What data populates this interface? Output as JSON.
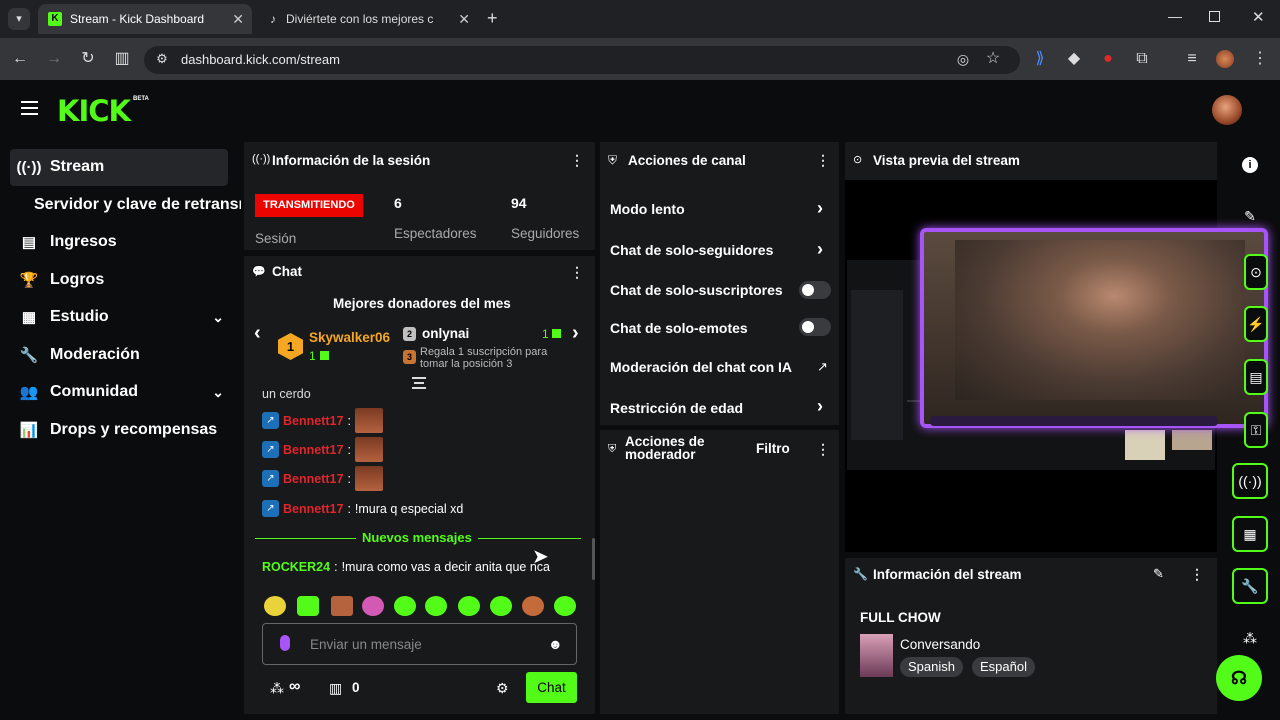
{
  "browser": {
    "tabs": [
      {
        "label": "Stream - Kick Dashboard"
      },
      {
        "label": "Diviértete con los mejores c"
      }
    ],
    "url": "dashboard.kick.com/stream"
  },
  "logo": {
    "text": "KICK",
    "beta": "BETA"
  },
  "sidebar": {
    "items": [
      {
        "label": "Stream"
      },
      {
        "label": "Servidor y clave de retransm"
      },
      {
        "label": "Ingresos"
      },
      {
        "label": "Logros"
      },
      {
        "label": "Estudio"
      },
      {
        "label": "Moderación"
      },
      {
        "label": "Comunidad"
      },
      {
        "label": "Drops y recompensas"
      }
    ]
  },
  "session": {
    "title": "Información de la sesión",
    "status": "TRANSMITIENDO",
    "status_label": "Sesión",
    "viewers": "6",
    "viewers_label": "Espectadores",
    "followers": "94",
    "followers_label": "Seguidores"
  },
  "chat": {
    "title": "Chat",
    "donors_title": "Mejores donadores del mes",
    "donor1": {
      "rank": "1",
      "name": "Skywalker06",
      "count": "1"
    },
    "donor2": {
      "rank": "2",
      "name": "onlynai",
      "count": "1"
    },
    "donor3": {
      "rank": "3",
      "text": "Regala 1 suscripción para tomar la posición 3"
    },
    "cut_text": "un cerdo",
    "messages": [
      {
        "user": "Bennett17",
        "text": ""
      },
      {
        "user": "Bennett17",
        "text": ""
      },
      {
        "user": "Bennett17",
        "text": ""
      },
      {
        "user": "Bennett17",
        "text": "!mura q especial xd"
      }
    ],
    "new_messages": "Nuevos mensajes",
    "latest": {
      "user": "ROCKER24",
      "text": "!mura como vas a decir anita que nca"
    },
    "input_placeholder": "Enviar un mensaje",
    "points": "∞",
    "shop_count": "0",
    "send_label": "Chat"
  },
  "channel_actions": {
    "title": "Acciones de canal",
    "rows": [
      {
        "label": "Modo lento"
      },
      {
        "label": "Chat de solo-seguidores"
      },
      {
        "label": "Chat de solo-suscriptores"
      },
      {
        "label": "Chat de solo-emotes"
      },
      {
        "label": "Moderación del chat con IA"
      },
      {
        "label": "Restricción de edad"
      }
    ]
  },
  "mod_actions": {
    "title": "Acciones de moderador",
    "filter": "Filtro"
  },
  "preview": {
    "title": "Vista previa del stream"
  },
  "stream_info": {
    "title": "Información del stream",
    "stream_title": "FULL CHOW",
    "category": "Conversando",
    "tags": [
      "Spanish",
      "Español"
    ]
  },
  "colors": {
    "brand": "#53fc18",
    "live": "#eb0400",
    "panel": "#18191b"
  }
}
